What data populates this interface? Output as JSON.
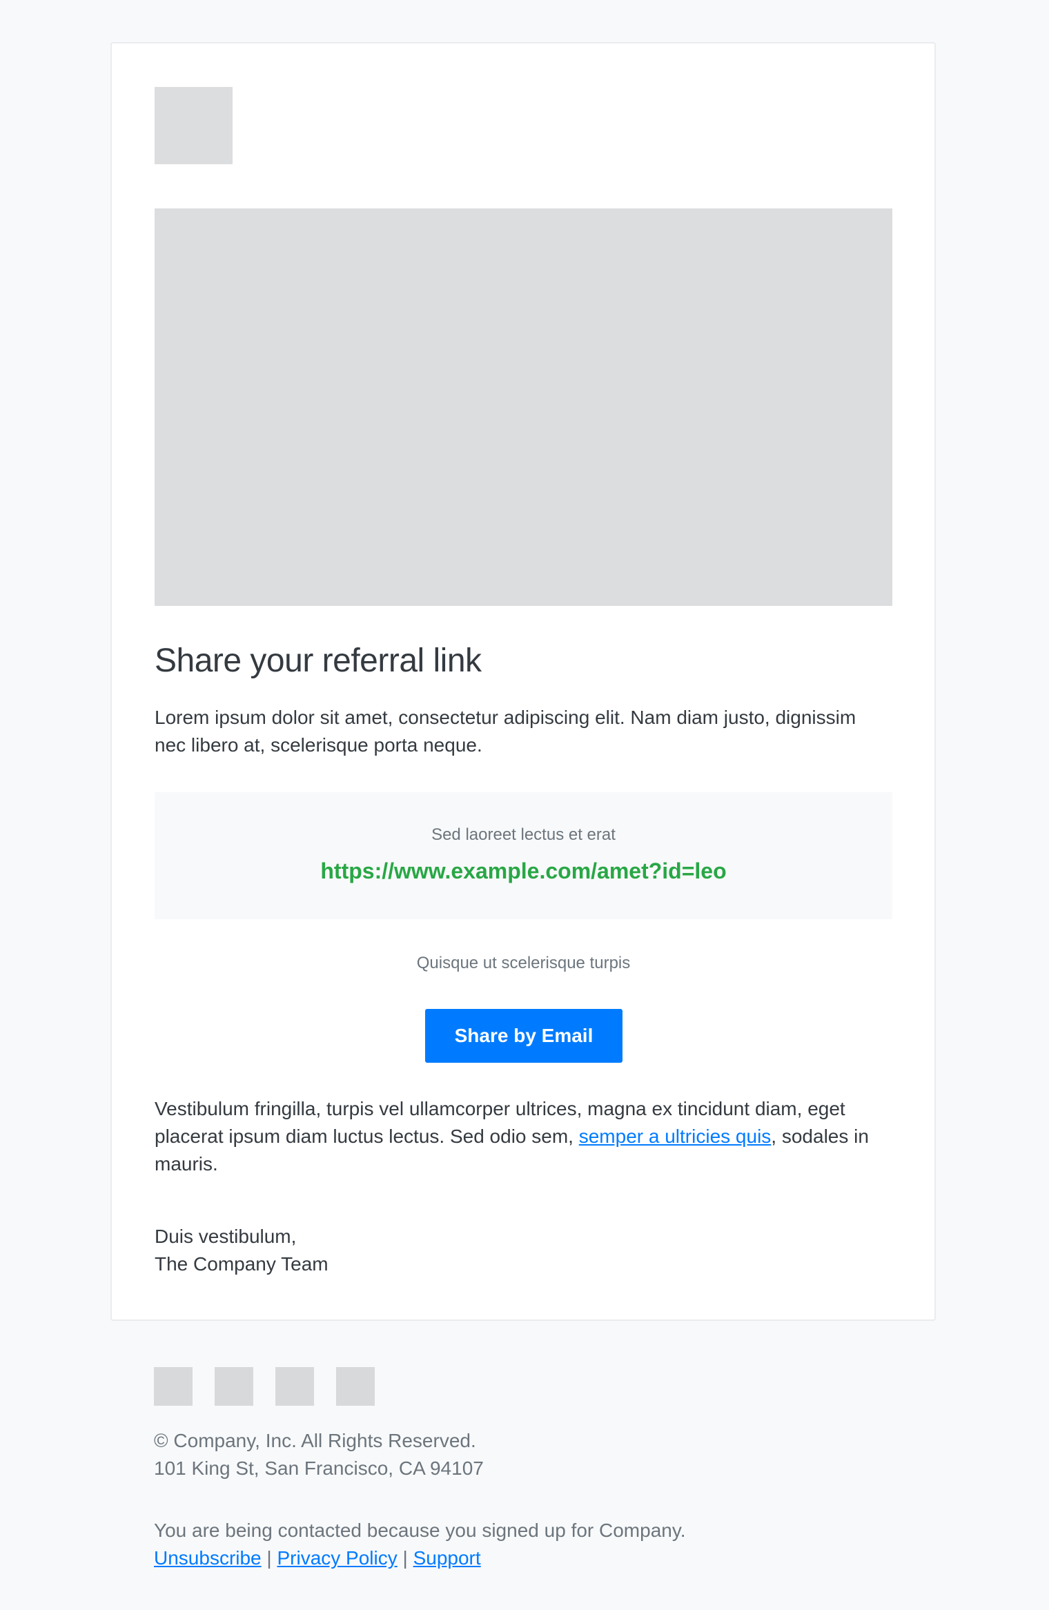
{
  "colors": {
    "page_background": "#f8f9fa",
    "card_background": "#ffffff",
    "placeholder": "#dcdddf",
    "heading_text": "#343a40",
    "muted_text": "#6c757d",
    "referral_link": "#28a745",
    "accent": "#007bff"
  },
  "email": {
    "logo_icon": "logo-placeholder",
    "hero_icon": "hero-image-placeholder",
    "title": "Share your referral link",
    "intro": "Lorem ipsum dolor sit amet, consectetur adipiscing elit. Nam diam justo, dignissim nec libero at, scelerisque porta neque.",
    "referral": {
      "caption": "Sed laoreet lectus et erat",
      "link": "https://www.example.com/amet?id=leo"
    },
    "share_caption": "Quisque ut scelerisque turpis",
    "share_button_label": "Share by Email",
    "body": {
      "before_link": "Vestibulum fringilla, turpis vel ullamcorper ultrices, magna ex tincidunt diam, eget placerat ipsum diam luctus lectus. Sed odio sem, ",
      "link_text": "semper a ultricies quis",
      "after_link": ", sodales in mauris."
    },
    "signoff_line1": "Duis vestibulum,",
    "signoff_line2": "The Company Team"
  },
  "footer": {
    "social_icons": [
      "social-icon-1",
      "social-icon-2",
      "social-icon-3",
      "social-icon-4"
    ],
    "copyright": "© Company, Inc. All Rights Reserved.",
    "address": "101 King St, San Francisco, CA 94107",
    "notice": "You are being contacted because you signed up for Company.",
    "links": {
      "unsubscribe": "Unsubscribe",
      "privacy": "Privacy Policy",
      "support": "Support",
      "separator": "|"
    }
  }
}
